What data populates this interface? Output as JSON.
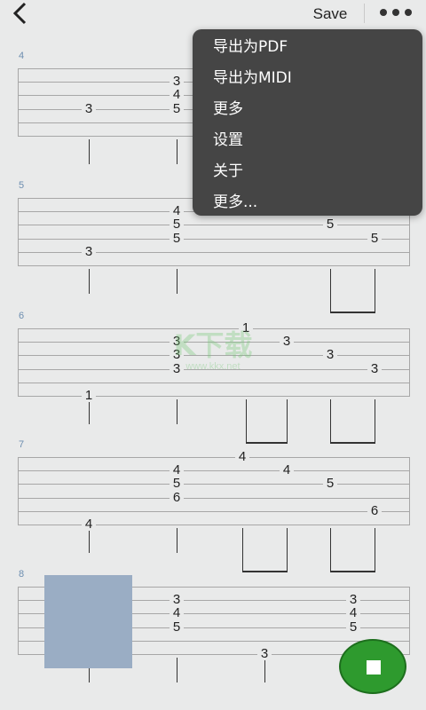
{
  "toolbar": {
    "save_label": "Save",
    "back_icon": "chevron-left-icon",
    "more_icon": "more-horizontal-icon"
  },
  "menu": {
    "items": [
      {
        "label": "导出为PDF"
      },
      {
        "label": "导出为MIDI"
      },
      {
        "label": "更多"
      },
      {
        "label": "设置"
      },
      {
        "label": "关于"
      },
      {
        "label": "更多..."
      }
    ]
  },
  "measures": [
    {
      "number": "4",
      "notes": [
        {
          "string": 3,
          "fret": "3"
        },
        {
          "string": 1,
          "fret": "3"
        },
        {
          "string": 2,
          "fret": "4"
        },
        {
          "string": 3,
          "fret": "5"
        },
        {
          "string": 1,
          "fret": "3"
        },
        {
          "string": 2,
          "fret": "4"
        },
        {
          "string": 3,
          "fret": "5"
        }
      ]
    },
    {
      "number": "5",
      "notes": [
        {
          "string": 4,
          "fret": "3"
        },
        {
          "string": 1,
          "fret": "4"
        },
        {
          "string": 2,
          "fret": "5"
        },
        {
          "string": 3,
          "fret": "5"
        },
        {
          "string": 2,
          "fret": "5"
        },
        {
          "string": 3,
          "fret": "5"
        }
      ]
    },
    {
      "number": "6",
      "notes": [
        {
          "string": 5,
          "fret": "1"
        },
        {
          "string": 1,
          "fret": "3"
        },
        {
          "string": 2,
          "fret": "3"
        },
        {
          "string": 3,
          "fret": "3"
        },
        {
          "string": 0,
          "fret": "1"
        },
        {
          "string": 1,
          "fret": "3"
        },
        {
          "string": 2,
          "fret": "3"
        },
        {
          "string": 3,
          "fret": "3"
        }
      ]
    },
    {
      "number": "7",
      "notes": [
        {
          "string": 5,
          "fret": "4"
        },
        {
          "string": 1,
          "fret": "4"
        },
        {
          "string": 2,
          "fret": "5"
        },
        {
          "string": 3,
          "fret": "6"
        },
        {
          "string": 0,
          "fret": "4"
        },
        {
          "string": 1,
          "fret": "4"
        },
        {
          "string": 2,
          "fret": "5"
        },
        {
          "string": 4,
          "fret": "6"
        }
      ]
    },
    {
      "number": "8",
      "notes": [
        {
          "string": 5,
          "fret": "3"
        },
        {
          "string": 1,
          "fret": "3"
        },
        {
          "string": 2,
          "fret": "4"
        },
        {
          "string": 3,
          "fret": "5"
        },
        {
          "string": 5,
          "fret": "3"
        },
        {
          "string": 1,
          "fret": "3"
        },
        {
          "string": 2,
          "fret": "4"
        },
        {
          "string": 3,
          "fret": "5"
        }
      ]
    }
  ],
  "watermark": {
    "big": "K下载",
    "small": "www.kkx.net"
  },
  "fab": {
    "icon": "stop-square-icon"
  }
}
